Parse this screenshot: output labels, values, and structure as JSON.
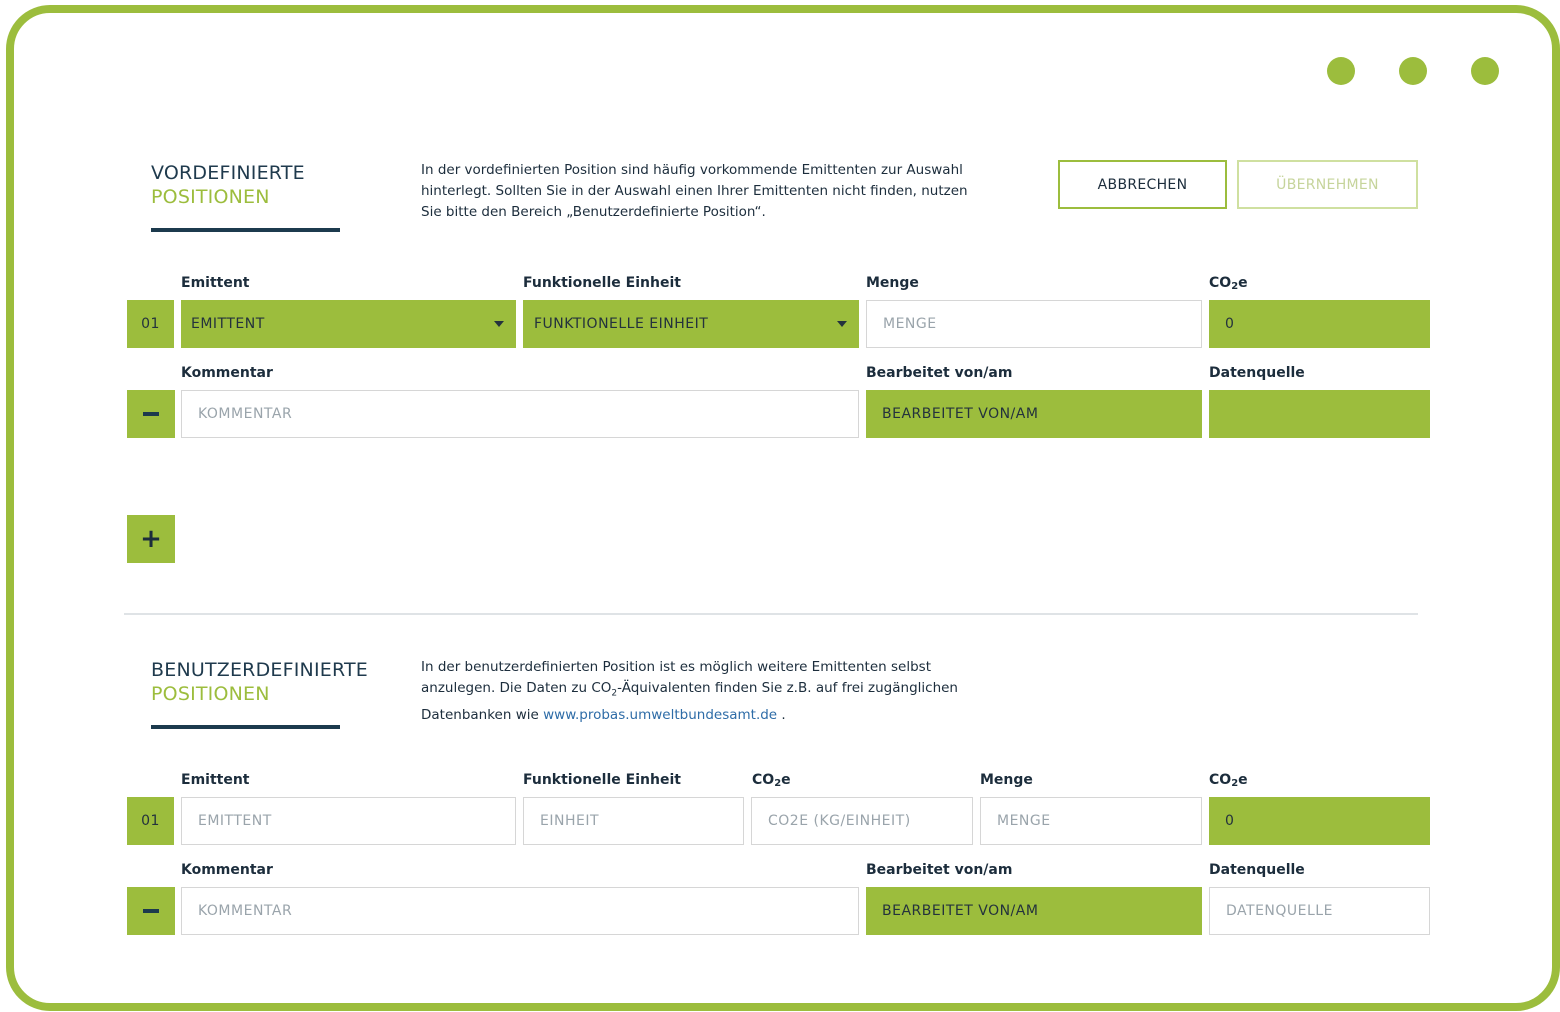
{
  "window_controls": [
    "dot",
    "dot",
    "dot"
  ],
  "predefined": {
    "title_line1": "VORDEFINIERTE",
    "title_line2": "POSITIONEN",
    "description_line1": "In der vordefinierten Position sind häufig vorkommende Emittenten zur Auswahl",
    "description_line2": "hinterlegt. Sollten Sie in der Auswahl einen Ihrer Emittenten nicht finden, nutzen",
    "description_line3": "Sie bitte den Bereich „Benutzerdefinierte Position“.",
    "cancel_label": "ABBRECHEN",
    "apply_label": "ÜBERNEHMEN",
    "labels": {
      "emittent": "Emittent",
      "funktionelle_einheit": "Funktionelle Einheit",
      "menge": "Menge",
      "co2e_prefix": "CO",
      "co2e_sub": "2",
      "co2e_suffix": "e",
      "kommentar": "Kommentar",
      "bearbeitet": "Bearbeitet von/am",
      "datenquelle": "Datenquelle"
    },
    "row": {
      "number": "01",
      "emittent_value": "EMITTENT",
      "einheit_value": "FUNKTIONELLE EINHEIT",
      "menge_placeholder": "MENGE",
      "co2e_value": "0",
      "kommentar_placeholder": "KOMMENTAR",
      "bearbeitet_value": "BEARBEITET VON/AM",
      "datenquelle_value": ""
    },
    "add_label": "+"
  },
  "custom": {
    "title_line1": "BENUTZERDEFINIERTE",
    "title_line2": "POSITIONEN",
    "description_line1": "In der benutzerdefinierten Position ist es möglich weitere Emittenten selbst",
    "description_line2a": "anzulegen. Die Daten zu CO",
    "description_line2_sub": "2",
    "description_line2b": "-Äquivalenten finden Sie z.B. auf frei zugänglichen",
    "description_line3a": "Datenbanken wie ",
    "description_link": "www.probas.umweltbundesamt.de",
    "description_line3b": " .",
    "labels": {
      "emittent": "Emittent",
      "funktionelle_einheit": "Funktionelle Einheit",
      "co2e_factor_prefix": "CO",
      "co2e_factor_sub": "2",
      "co2e_factor_suffix": "e",
      "menge": "Menge",
      "co2e_prefix": "CO",
      "co2e_sub": "2",
      "co2e_suffix": "e",
      "kommentar": "Kommentar",
      "bearbeitet": "Bearbeitet von/am",
      "datenquelle": "Datenquelle"
    },
    "row": {
      "number": "01",
      "emittent_placeholder": "EMITTENT",
      "einheit_placeholder": "EINHEIT",
      "co2e_factor_placeholder": "CO2E (KG/EINHEIT)",
      "menge_placeholder": "MENGE",
      "co2e_value": "0",
      "kommentar_placeholder": "KOMMENTAR",
      "bearbeitet_value": "BEARBEITET VON/AM",
      "datenquelle_placeholder": "DATENQUELLE"
    }
  },
  "colors": {
    "accent": "#9cbd3d",
    "dark": "#1c3a4d",
    "link": "#2e6ca7"
  }
}
